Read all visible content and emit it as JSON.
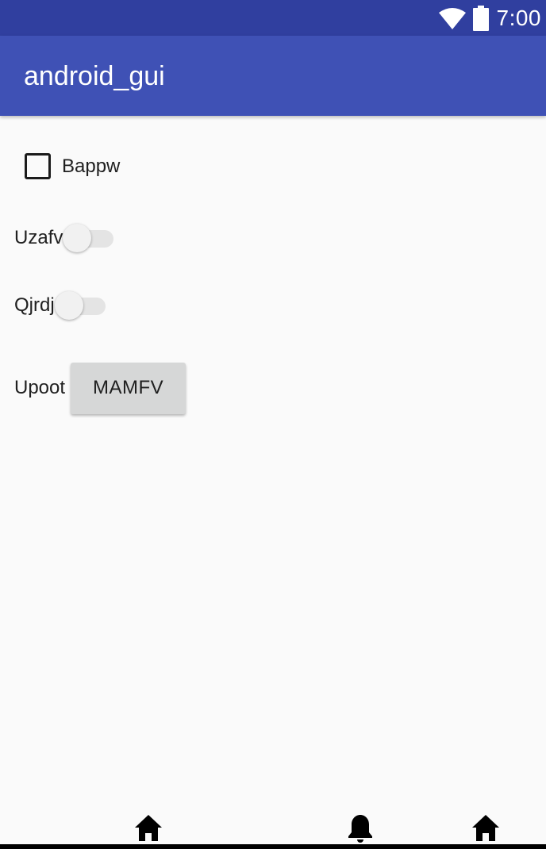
{
  "status_bar": {
    "time": "7:00",
    "icons": [
      "wifi-icon",
      "battery-icon"
    ],
    "color": "#303f9f"
  },
  "app_bar": {
    "title": "android_gui",
    "color": "#3f51b5"
  },
  "checkbox": {
    "label": "Bappw",
    "checked": false
  },
  "switches": [
    {
      "label": "Uzafv",
      "on": false
    },
    {
      "label": "Qjrdj",
      "on": false
    }
  ],
  "button_row": {
    "label": "Upoot",
    "button_label": "MAMFV"
  },
  "bottom_icons": [
    "home-icon",
    "bell-icon",
    "home-icon"
  ]
}
